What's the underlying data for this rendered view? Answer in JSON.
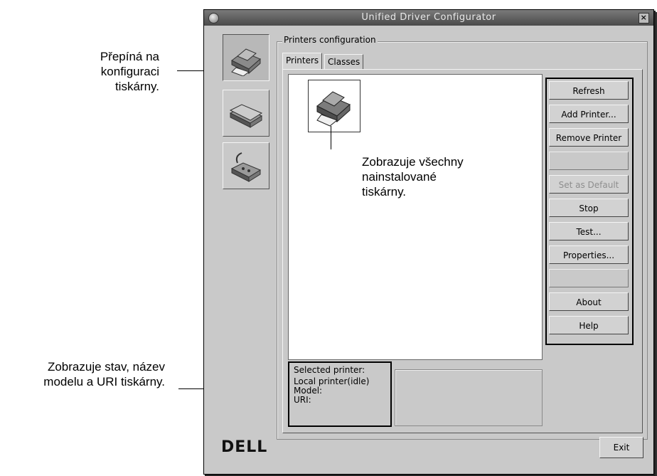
{
  "window": {
    "title": "Unified Driver Configurator",
    "close_symbol": "×"
  },
  "nav": {
    "items": [
      {
        "name": "printers",
        "icon": "printer-icon",
        "selected": true
      },
      {
        "name": "scanners",
        "icon": "scanner-icon",
        "selected": false
      },
      {
        "name": "ports",
        "icon": "port-icon",
        "selected": false
      }
    ]
  },
  "group": {
    "legend": "Printers configuration"
  },
  "tabs": [
    {
      "label": "Printers",
      "active": true
    },
    {
      "label": "Classes",
      "active": false
    }
  ],
  "buttons": [
    {
      "label": "Refresh",
      "enabled": true
    },
    {
      "label": "Add Printer...",
      "enabled": true
    },
    {
      "label": "Remove Printer",
      "enabled": true
    },
    {
      "label": "",
      "enabled": false
    },
    {
      "label": "Set as Default",
      "enabled": false
    },
    {
      "label": "Stop",
      "enabled": true
    },
    {
      "label": "Test...",
      "enabled": true
    },
    {
      "label": "Properties...",
      "enabled": true
    },
    {
      "label": "",
      "enabled": false
    },
    {
      "label": "About",
      "enabled": true
    },
    {
      "label": "Help",
      "enabled": true
    }
  ],
  "status": {
    "heading": "Selected printer:",
    "printer": "Local printer(idle)",
    "model_label": "Model:",
    "uri_label": "URI:"
  },
  "footer": {
    "brand": "DELL",
    "exit_label": "Exit"
  },
  "annotations": {
    "nav_note": [
      "Přepíná na",
      "konfiguraci",
      "tiskárny."
    ],
    "list_note": [
      "Zobrazuje všechny",
      "nainstalované",
      "tiskárny."
    ],
    "status_note": [
      "Zobrazuje stav, název",
      "modelu a URI tiskárny."
    ]
  },
  "colors": {
    "window_bg": "#c9c9c9",
    "titlebar": "#5a5a5a",
    "list_bg": "#ffffff"
  }
}
